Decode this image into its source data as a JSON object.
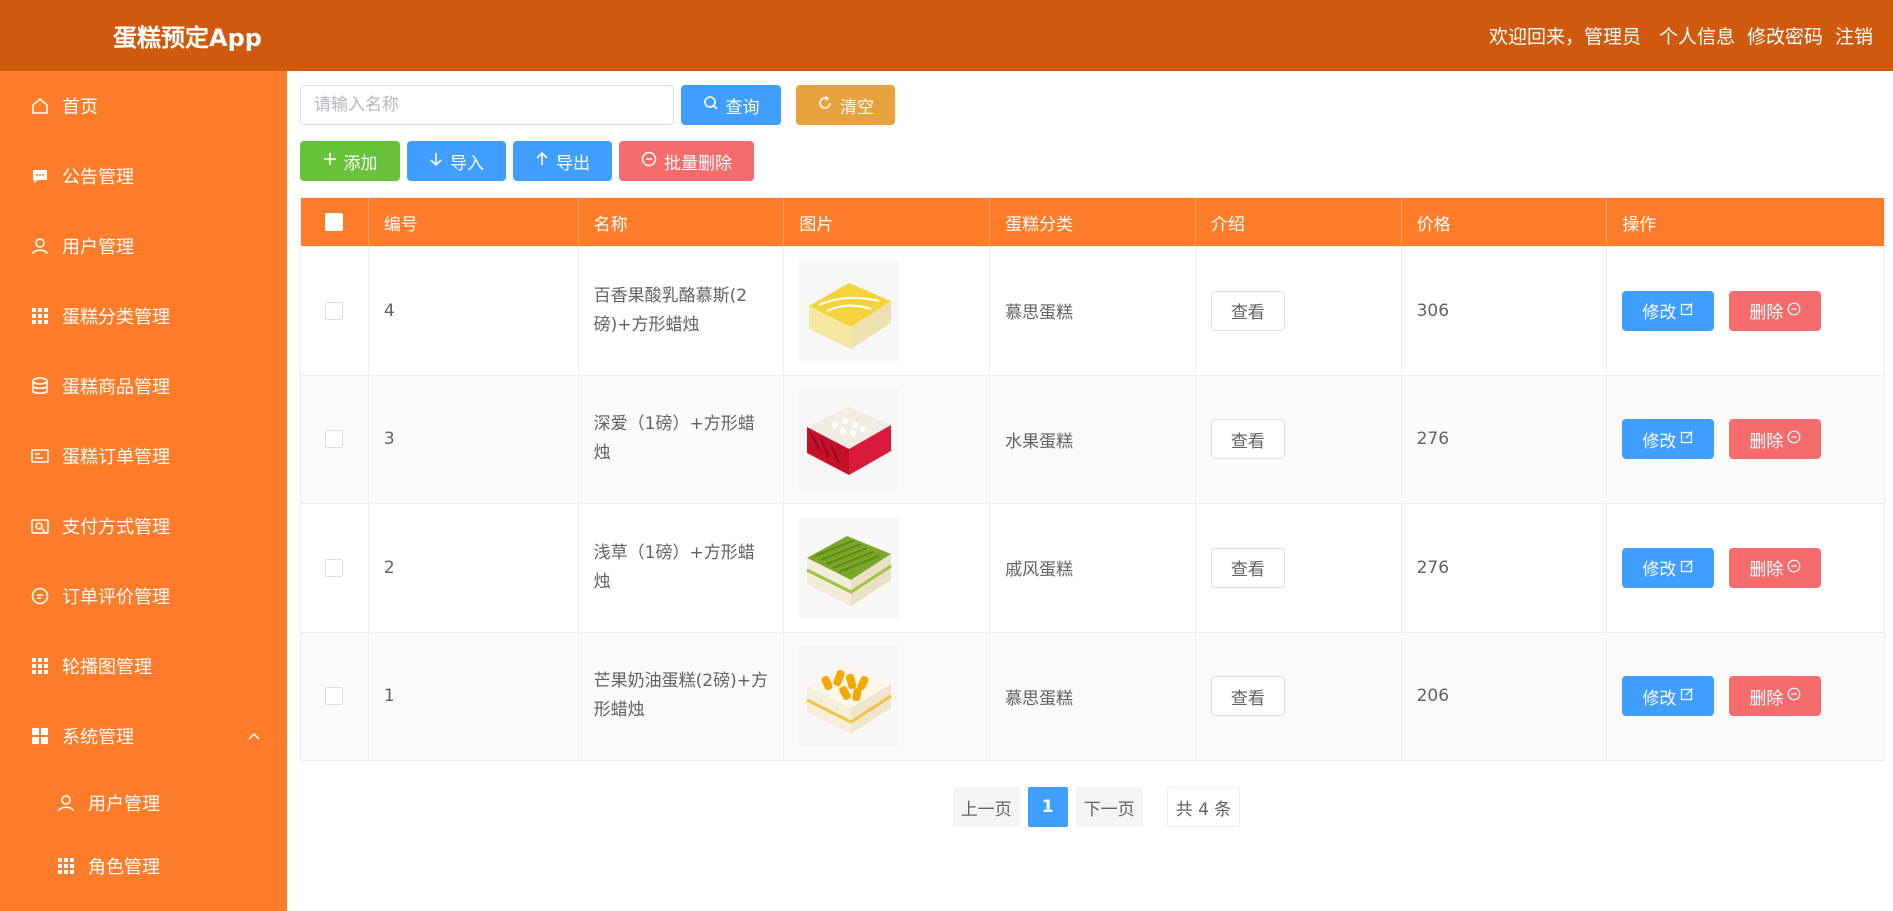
{
  "header": {
    "app_title": "蛋糕预定App",
    "welcome": "欢迎回来，管理员",
    "profile": "个人信息",
    "change_password": "修改密码",
    "logout": "注销"
  },
  "sidebar": {
    "items": [
      {
        "label": "首页",
        "icon": "home-icon"
      },
      {
        "label": "公告管理",
        "icon": "message-icon"
      },
      {
        "label": "用户管理",
        "icon": "user-icon"
      },
      {
        "label": "蛋糕分类管理",
        "icon": "grid-icon"
      },
      {
        "label": "蛋糕商品管理",
        "icon": "database-icon"
      },
      {
        "label": "蛋糕订单管理",
        "icon": "order-icon"
      },
      {
        "label": "支付方式管理",
        "icon": "wallet-icon"
      },
      {
        "label": "订单评价管理",
        "icon": "chat-icon"
      },
      {
        "label": "轮播图管理",
        "icon": "grid-icon"
      },
      {
        "label": "系统管理",
        "icon": "menu-icon",
        "expanded": true
      }
    ],
    "sub_items": [
      {
        "label": "用户管理",
        "icon": "user-icon"
      },
      {
        "label": "角色管理",
        "icon": "grid-icon"
      }
    ]
  },
  "search": {
    "placeholder": "请输入名称",
    "query_label": "查询",
    "clear_label": "清空"
  },
  "actions": {
    "add": "添加",
    "import": "导入",
    "export": "导出",
    "batch_delete": "批量删除"
  },
  "table": {
    "headers": [
      "编号",
      "名称",
      "图片",
      "蛋糕分类",
      "介绍",
      "价格",
      "操作"
    ],
    "rows": [
      {
        "id": "4",
        "name": "百香果酸乳酪慕斯(2磅)+方形蜡烛",
        "category": "慕思蛋糕",
        "intro": "查看",
        "price": "306",
        "edit": "修改",
        "delete": "删除",
        "image": "yellow-cake"
      },
      {
        "id": "3",
        "name": "深爱（1磅）+方形蜡烛",
        "category": "水果蛋糕",
        "intro": "查看",
        "price": "276",
        "edit": "修改",
        "delete": "删除",
        "image": "red-cake"
      },
      {
        "id": "2",
        "name": "浅草（1磅）+方形蜡烛",
        "category": "戚风蛋糕",
        "intro": "查看",
        "price": "276",
        "edit": "修改",
        "delete": "删除",
        "image": "green-cake"
      },
      {
        "id": "1",
        "name": "芒果奶油蛋糕(2磅)+方形蜡烛",
        "category": "慕思蛋糕",
        "intro": "查看",
        "price": "206",
        "edit": "修改",
        "delete": "删除",
        "image": "mango-cake"
      }
    ]
  },
  "pagination": {
    "prev": "上一页",
    "current": "1",
    "next": "下一页",
    "total": "共 4 条"
  },
  "colors": {
    "header": "#cf5a0e",
    "sidebar": "#fe7c2a",
    "primary": "#409eff",
    "warning": "#e6a23c",
    "success": "#67c23a",
    "danger": "#f56c6c"
  }
}
